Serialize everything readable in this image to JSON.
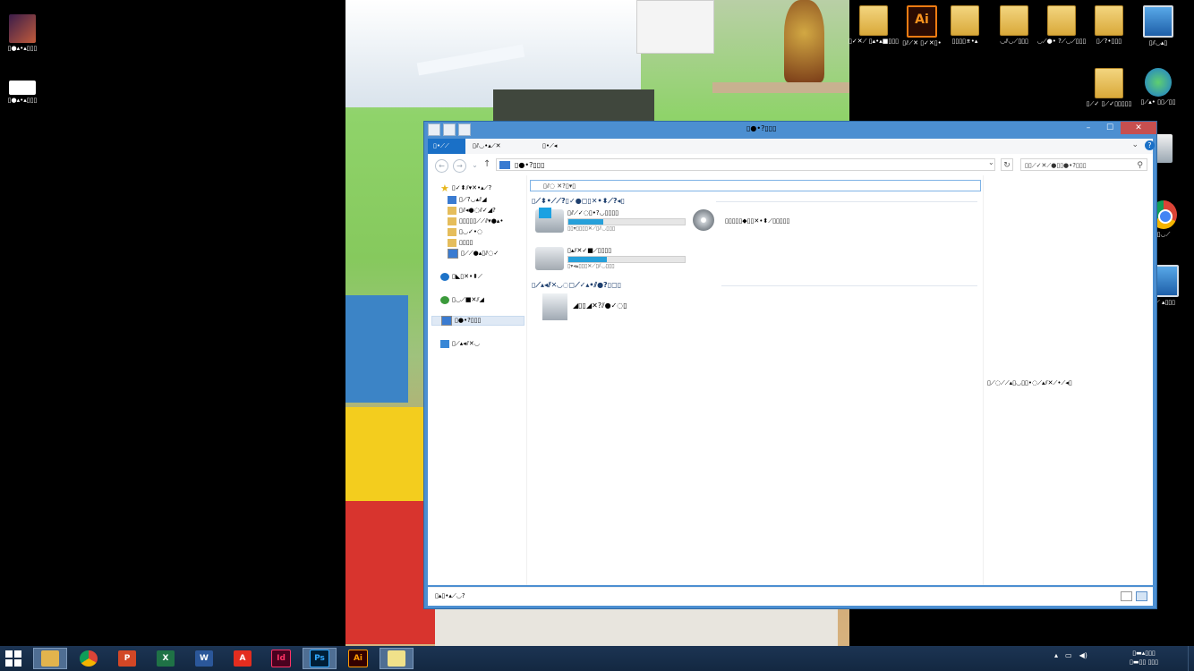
{
  "desktop_left_icons": [
    {
      "label": "▯●▴•▴▯▯▯",
      "kind": "pic"
    },
    {
      "label": "▯●▴•▴▯▯▯",
      "kind": "white"
    }
  ],
  "desktop_right_icons": [
    {
      "label": "▯✓✕⟋ ▯▴•▴■▯▯▯",
      "kind": "folder"
    },
    {
      "label": "▯⫽⟋✕ ▯✓✕▯•",
      "kind": "ai",
      "glyph": "Ai"
    },
    {
      "label": "▯▯▯▯⌆•▴",
      "kind": "folder"
    },
    {
      "label": "◡⫽◡⟋▯▯▯",
      "kind": "folder"
    },
    {
      "label": "◡⟋●• ?⟋◡⟋▯▯▯",
      "kind": "folder"
    },
    {
      "label": "▯⟋?•▯▯▯",
      "kind": "folder"
    },
    {
      "label": "▯⫽◡▴▯",
      "kind": "pc"
    },
    {
      "label": "▯⟋✓ ▯⟋✓▯▯▯▯▯",
      "kind": "folder"
    },
    {
      "label": "▯⟋▴• ▯▯⟋▯▯",
      "kind": "net"
    },
    {
      "label": "",
      "kind": "bin"
    },
    {
      "label": "▯◡⟋",
      "kind": "chrome"
    },
    {
      "label": "▯⟋ ▴▯▯▯",
      "kind": "pc"
    }
  ],
  "window": {
    "title": "▯●•?▯▯▯",
    "tabs": {
      "file": "▯•⟋⟋",
      "computer": "▯⫽◡•▴⟋✕",
      "view": "▯•⟋◂"
    },
    "address": "▯●•?▯▯▯",
    "search_placeholder": "▯▯⟋✓✕⟋●▯▯●•?▯▯▯",
    "info_bar": "▯⫽◌ ✕?▯▾▯",
    "nav": {
      "favorites": "▯✓⬍⫽▾✕•▴⟋?",
      "fav_items": [
        "▯⟋?◡▴⫽◢",
        "▯⫽◂●◌⫽✓◢?",
        "▯▯▯▯▯⟋⟋⫽▾●▴•",
        "▯◡✓•◌",
        "▯▯▯▯",
        "▯⟋⟋●▴▯⫽◌✓"
      ],
      "onedrive": "▯◣▯✕•⬍⟋",
      "homegroup": "▯◡⟋■✕⫽◢",
      "this_pc": "▯●•?▯▯▯",
      "network": "▯⟋▴◂⫽✕◡"
    },
    "groups": {
      "devices": "▯⟋⬍•⟋⟋?▯✓●◻▯✕•⬍⟋?◂▯",
      "network_locations": "▯⟋▴◂⫽✕◡◌◻⟋✓▴•⫽●?▯◻▯"
    },
    "drives": [
      {
        "name": "▯⫽⟋✓◌▯•?◡▯▯▯▯",
        "size": "▯▯▾▯▯▯▯✕⟋▯⫽◡▯▯▯",
        "fill_pct": 30,
        "kind": "win"
      },
      {
        "name": "▯▴⫽✕✓■⟋▯▯▯▯",
        "size": "▯▾◂▴▯▯▯✕⟋▯⫽◡▯▯▯",
        "fill_pct": 33,
        "kind": "hdd"
      },
      {
        "name": "▯▯▯▯▯◆▯▯✕•⬍⟋▯▯▯▯▯",
        "size": "",
        "fill_pct": null,
        "kind": "dvd"
      }
    ],
    "network_location": "◢▯▯◢✕?⫽●✓◌▯",
    "preview_message": "▯⟋◌⟋⟋▴▯◡▯▯•◌⟋▴⫽✕⟋•⟋◂▯",
    "status": "▯▴▯•▴⟋◡?"
  },
  "taskbar": {
    "apps": [
      {
        "name": "file-explorer",
        "label": "",
        "color": "#e2b44d",
        "active": true
      },
      {
        "name": "chrome",
        "label": "",
        "color": "#db4437",
        "active": false
      },
      {
        "name": "powerpoint",
        "label": "P",
        "color": "#d24726",
        "active": false
      },
      {
        "name": "excel",
        "label": "X",
        "color": "#1f7246",
        "active": false
      },
      {
        "name": "word",
        "label": "W",
        "color": "#2b579a",
        "active": false
      },
      {
        "name": "acrobat",
        "label": "A",
        "color": "#e42d1f",
        "active": false
      },
      {
        "name": "indesign",
        "label": "Id",
        "color": "#ff3366",
        "active": false
      },
      {
        "name": "photoshop",
        "label": "Ps",
        "color": "#31a8ff",
        "active": false
      },
      {
        "name": "illustrator",
        "label": "Ai",
        "color": "#ff9a00",
        "active": false
      },
      {
        "name": "sticky",
        "label": "",
        "color": "#f0e18a",
        "active": false
      }
    ],
    "time": "▯▬▴▯▯▯",
    "date": "▯▬▯▯ ▯▯▯"
  }
}
